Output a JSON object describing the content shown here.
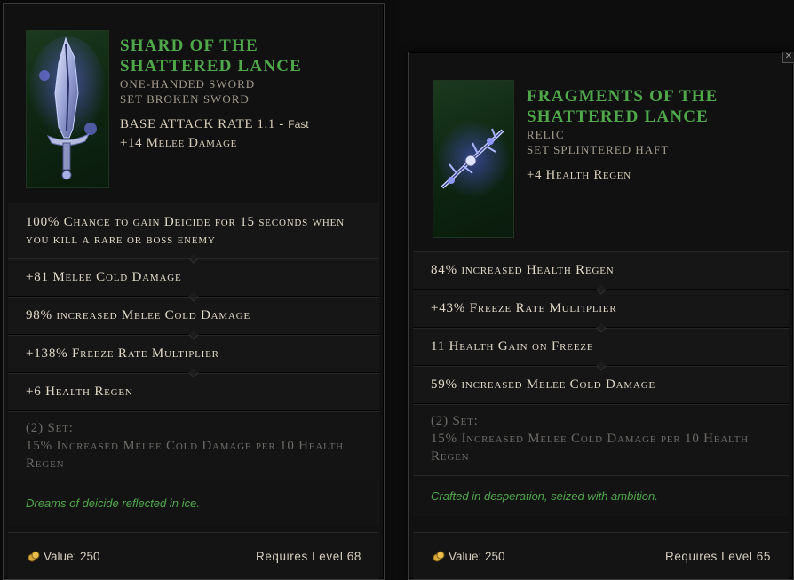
{
  "colors": {
    "name": "#4fa94a",
    "lore": "#4fa94a",
    "set_text": "#6c6a66"
  },
  "tooltip1": {
    "name": "Shard of the Shattered Lance",
    "type": "One-Handed Sword",
    "set": "Set Broken Sword",
    "base_attack_rate": "Base Attack Rate 1.1 -",
    "attack_speed": "Fast",
    "implicit": "+14 Melee Damage",
    "image_icon": "sword-icon",
    "affixes": [
      "100% Chance to gain Deicide for 15 seconds when you kill a rare or boss enemy",
      "+81 Melee Cold Damage",
      "98% increased Melee Cold Damage",
      "+138% Freeze Rate Multiplier",
      "+6 Health Regen"
    ],
    "set_bonus_title": "(2) Set:",
    "set_bonus_text": "15% Increased Melee Cold Damage per 10 Health Regen",
    "lore": "Dreams of deicide reflected in ice.",
    "value": "Value: 250",
    "requires": "Requires Level 68"
  },
  "tooltip2": {
    "name": "Fragments of the Shattered Lance",
    "type": "Relic",
    "set": "Set Splintered Haft",
    "implicit": "+4 Health Regen",
    "image_icon": "relic-icon",
    "affixes": [
      "84% increased Health Regen",
      "+43% Freeze Rate Multiplier",
      "11 Health Gain on Freeze",
      "59% increased Melee Cold Damage"
    ],
    "set_bonus_title": "(2) Set:",
    "set_bonus_text": "15% Increased Melee Cold Damage per 10 Health Regen",
    "lore": "Crafted in desperation, seized with ambition.",
    "value": "Value: 250",
    "requires": "Requires Level 65",
    "close_glyph": "✕"
  }
}
